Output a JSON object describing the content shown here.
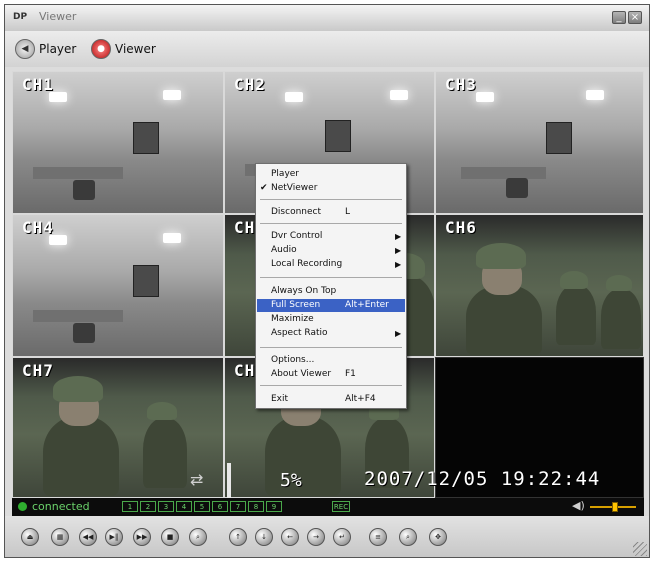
{
  "window": {
    "title": "Viewer",
    "app_icon": "DP",
    "minimize_glyph": "_",
    "close_glyph": "×"
  },
  "modes": {
    "player": {
      "label": "Player",
      "icon": "player-icon"
    },
    "viewer": {
      "label": "Viewer",
      "icon": "viewer-icon",
      "active_color": "#d01010"
    }
  },
  "channels": [
    {
      "label": "CH1"
    },
    {
      "label": "CH2"
    },
    {
      "label": "CH3"
    },
    {
      "label": "CH4"
    },
    {
      "label": "CH5"
    },
    {
      "label": "CH6"
    },
    {
      "label": "CH7"
    },
    {
      "label": "CH8"
    }
  ],
  "osd": {
    "percent": "5%",
    "datetime": "2007/12/05 19:22:44"
  },
  "status": {
    "connection": "connected",
    "channel_indicators": [
      "1",
      "2",
      "3",
      "4",
      "5",
      "6",
      "7",
      "8",
      "9"
    ],
    "record_badge": "REC",
    "volume_level": 0.55
  },
  "context_menu": {
    "items": [
      {
        "label": "Player",
        "checked": false
      },
      {
        "label": "NetViewer",
        "checked": true
      },
      {
        "label": "Disconnect",
        "shortcut": "L"
      },
      {
        "label": "Dvr Control",
        "submenu": true
      },
      {
        "label": "Audio",
        "submenu": true
      },
      {
        "label": "Local Recording",
        "submenu": true
      },
      {
        "label": "Always On Top"
      },
      {
        "label": "Full Screen",
        "shortcut": "Alt+Enter",
        "highlighted": true
      },
      {
        "label": "Maximize"
      },
      {
        "label": "Aspect Ratio",
        "submenu": true
      },
      {
        "label": "Options..."
      },
      {
        "label": "About Viewer",
        "shortcut": "F1"
      },
      {
        "label": "Exit",
        "shortcut": "Alt+F4"
      }
    ],
    "check_glyph": "✔",
    "submenu_glyph": "▶"
  },
  "toolbar": {
    "buttons": [
      {
        "name": "eject-button",
        "icon": "eject-icon",
        "glyph": "⏏"
      },
      {
        "name": "grid-button",
        "icon": "grid-icon",
        "glyph": "▦"
      },
      {
        "name": "rewind-button",
        "icon": "rewind-icon",
        "glyph": "◀◀"
      },
      {
        "name": "play-pause-button",
        "icon": "play-pause-icon",
        "glyph": "▶‖"
      },
      {
        "name": "fast-forward-button",
        "icon": "fast-forward-icon",
        "glyph": "▶▶"
      },
      {
        "name": "stop-button",
        "icon": "stop-icon",
        "glyph": "■"
      },
      {
        "name": "zoom-button",
        "icon": "zoom-icon",
        "glyph": "⌕"
      },
      {
        "name": "pan-up-button",
        "icon": "arrow-up-icon",
        "glyph": "↑"
      },
      {
        "name": "pan-down-button",
        "icon": "arrow-down-icon",
        "glyph": "↓"
      },
      {
        "name": "pan-left-button",
        "icon": "arrow-left-icon",
        "glyph": "←"
      },
      {
        "name": "pan-right-button",
        "icon": "arrow-right-icon",
        "glyph": "→"
      },
      {
        "name": "enter-button",
        "icon": "return-icon",
        "glyph": "↵"
      },
      {
        "name": "menu-button",
        "icon": "menu-icon",
        "glyph": "≡"
      },
      {
        "name": "search-button",
        "icon": "search-icon",
        "glyph": "⌕"
      },
      {
        "name": "ptz-button",
        "icon": "ptz-icon",
        "glyph": "✥"
      }
    ]
  },
  "colors": {
    "status_green": "#6bd36b",
    "menu_highlight": "#3b62c5",
    "volume": "#ffc400"
  }
}
